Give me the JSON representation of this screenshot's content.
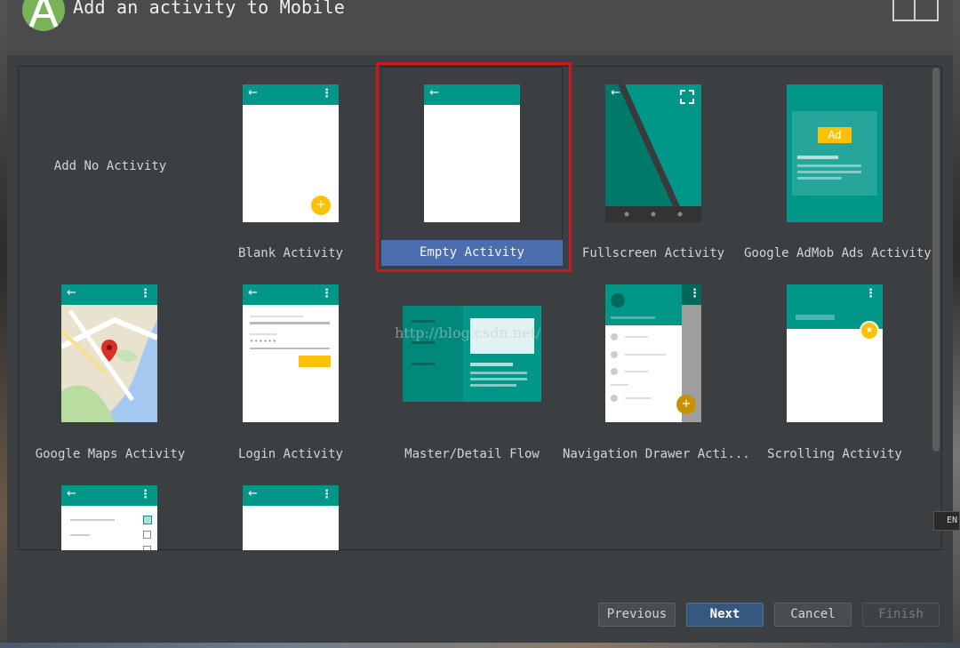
{
  "window": {
    "title": "Add an activity to Mobile"
  },
  "gallery": {
    "items": [
      {
        "label": "Add No Activity"
      },
      {
        "label": "Blank Activity"
      },
      {
        "label": "Empty Activity",
        "selected": true
      },
      {
        "label": "Fullscreen Activity"
      },
      {
        "label": "Google AdMob Ads Activity",
        "ad_badge": "Ad"
      },
      {
        "label": "Google Maps Activity"
      },
      {
        "label": "Login Activity",
        "password_mask": "••••••"
      },
      {
        "label": "Master/Detail Flow"
      },
      {
        "label": "Navigation Drawer Acti..."
      },
      {
        "label": "Scrolling Activity"
      },
      {
        "label": ""
      },
      {
        "label": ""
      }
    ]
  },
  "watermark": "http://blog.csdn.net/",
  "ime_indicator": "EN",
  "buttons": {
    "previous": {
      "label": "Previous",
      "enabled": true
    },
    "next": {
      "label": "Next",
      "enabled": true
    },
    "cancel": {
      "label": "Cancel",
      "enabled": true
    },
    "finish": {
      "label": "Finish",
      "enabled": false
    }
  },
  "colors": {
    "teal": "#009688",
    "accent": "#ffc107",
    "selection": "#4b6eaf",
    "highlight_border": "#d0161c"
  },
  "icons": {
    "app_logo": "android-studio-logo-icon",
    "device": "device-form-factor-icon"
  }
}
